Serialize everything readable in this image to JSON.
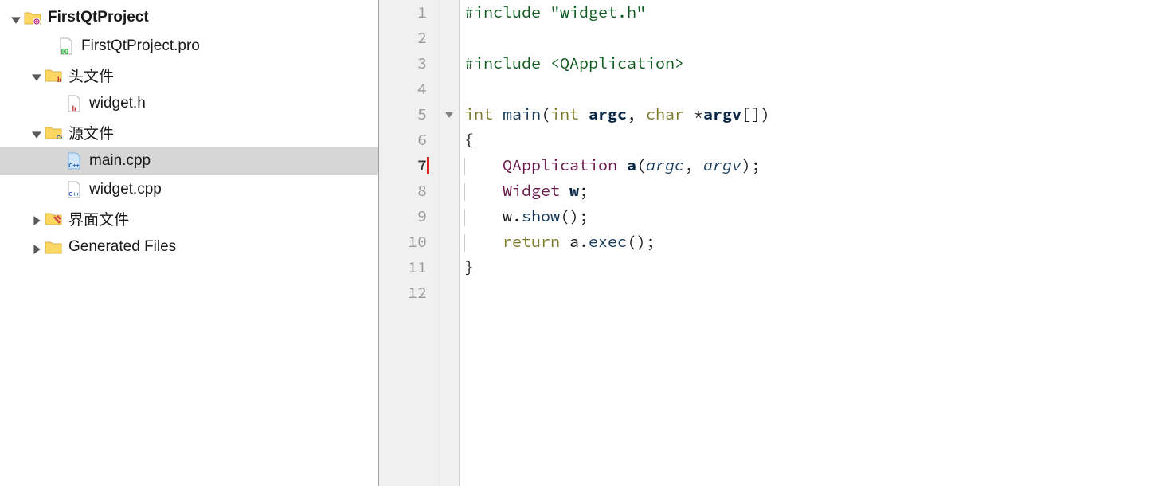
{
  "tree": {
    "root": {
      "label": "FirstQtProject"
    },
    "pro": {
      "label": "FirstQtProject.pro"
    },
    "headers": {
      "label": "头文件"
    },
    "widget_h": {
      "label": "widget.h"
    },
    "sources": {
      "label": "源文件"
    },
    "main_cpp": {
      "label": "main.cpp"
    },
    "widget_cpp": {
      "label": "widget.cpp"
    },
    "forms": {
      "label": "界面文件"
    },
    "generated": {
      "label": "Generated Files"
    }
  },
  "gutter": {
    "l1": "1",
    "l2": "2",
    "l3": "3",
    "l4": "4",
    "l5": "5",
    "l6": "6",
    "l7": "7",
    "l8": "8",
    "l9": "9",
    "l10": "10",
    "l11": "11",
    "l12": "12"
  },
  "code": {
    "l1_pp": "#include ",
    "l1_str": "\"widget.h\"",
    "l3_pp": "#include ",
    "l3_sys": "<QApplication>",
    "l5_int": "int",
    "l5_main": " main",
    "l5_open": "(",
    "l5_int2": "int",
    "l5_sp1": " ",
    "l5_argc": "argc",
    "l5_comma": ", ",
    "l5_char": "char",
    "l5_star": " *",
    "l5_argv": "argv",
    "l5_close": "[])",
    "l6": "{",
    "l7_cls": "QApplication",
    "l7_sp": " ",
    "l7_a": "a",
    "l7_open": "(",
    "l7_argc": "argc",
    "l7_comma": ", ",
    "l7_argv": "argv",
    "l7_close": ");",
    "l8_cls": "Widget",
    "l8_sp": " ",
    "l8_w": "w",
    "l8_semi": ";",
    "l9_w": "w",
    "l9_dot": ".",
    "l9_show": "show",
    "l9_call": "();",
    "l10_ret": "return",
    "l10_sp": " a.",
    "l10_exec": "exec",
    "l10_call": "();",
    "l11": "}"
  }
}
